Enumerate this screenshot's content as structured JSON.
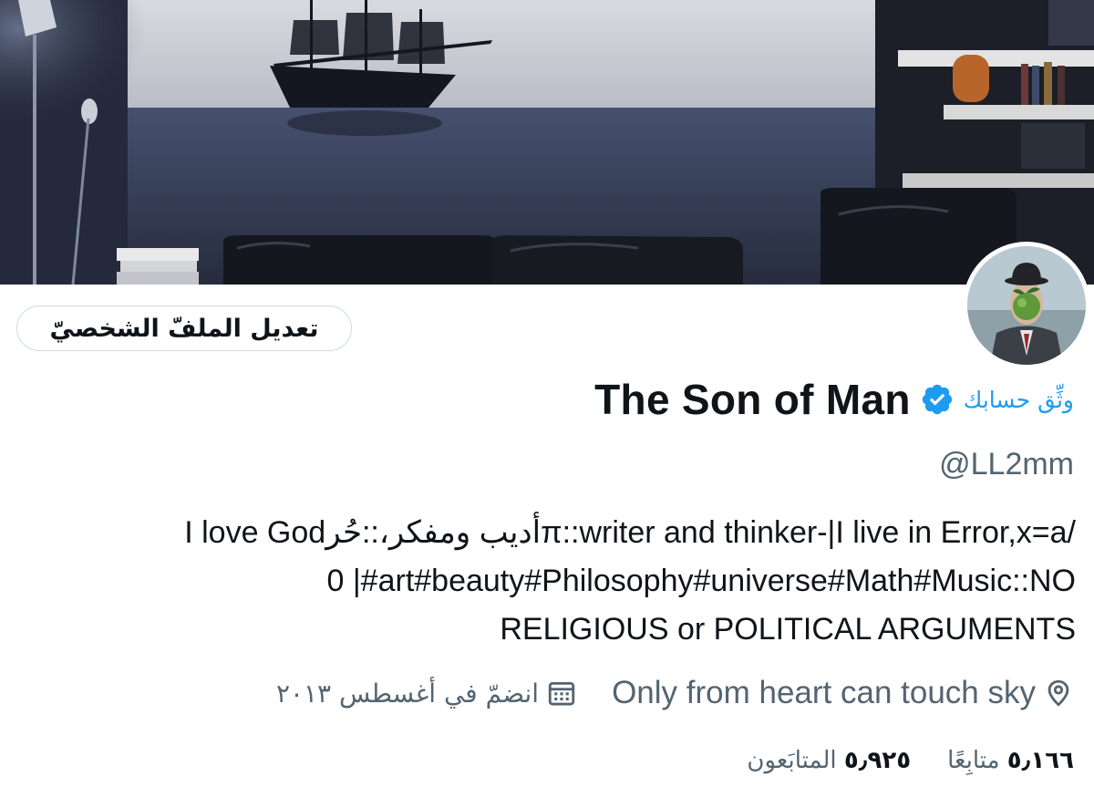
{
  "profile": {
    "edit_button_label": "تعديل الملفّ الشخصيّ",
    "verify_link": "وثِّق حسابك",
    "display_name": "The Son of Man",
    "handle": "@LL2mm",
    "bio_lines": [
      "I love Godأديب ومفكر،::حُرπ::writer and thinker-|I live in Error,x=a/",
      "0 |#art#beauty#Philosophy#universe#Math#Music::NO",
      "RELIGIOUS or POLITICAL ARGUMENTS"
    ],
    "location": "Only from heart can touch sky",
    "joined": "انضمّ في أغسطس ٢٠١٣",
    "followers_count": "٥٫٩٢٥",
    "followers_label": "المتابَعون",
    "following_count": "٥٫١٦٦",
    "following_label": "متابِعًا"
  },
  "icons": {
    "verified": "verified-badge-icon",
    "location": "location-pin-icon",
    "calendar": "calendar-icon"
  },
  "colors": {
    "accent": "#1d9bf0",
    "text_primary": "#0f1419",
    "text_secondary": "#536471",
    "border": "#cfd9de"
  }
}
